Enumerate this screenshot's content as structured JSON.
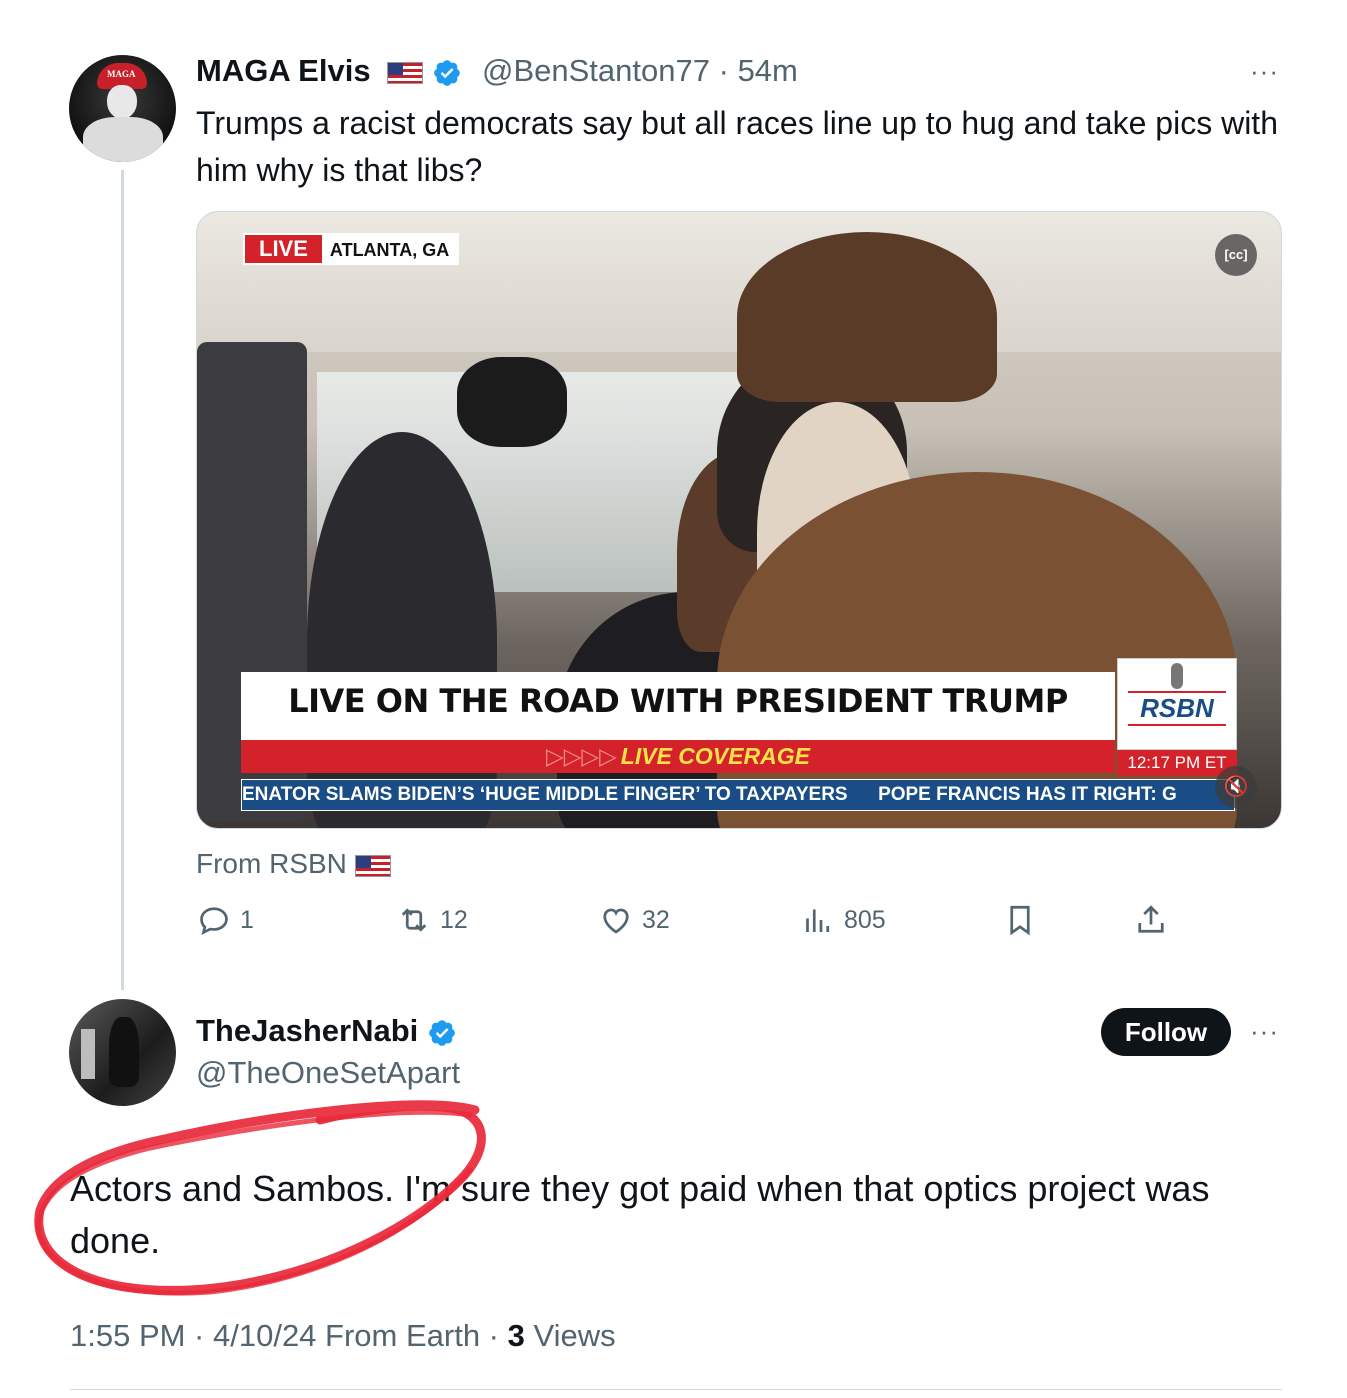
{
  "post": {
    "author_name": "MAGA Elvis",
    "author_handle": "@BenStanton77",
    "separator": "·",
    "time": "54m",
    "more": "···",
    "text": "Trumps a racist democrats say but all races line up to hug and take pics with him why is that libs?",
    "avatar_text": "MAGA",
    "media": {
      "live_label": "LIVE",
      "location": "ATLANTA, GA",
      "cc_label": "[cc]",
      "headline": "LIVE ON THE ROAD WITH PRESIDENT TRUMP",
      "subhead_arrows": "▷▷▷▷",
      "subhead": "LIVE COVERAGE",
      "ticker_1": "ENATOR SLAMS BIDEN’S ‘HUGE MIDDLE FINGER’ TO TAXPAYERS",
      "ticker_2": "POPE FRANCIS HAS IT RIGHT: G",
      "logo": "RSBN",
      "time": "12:17 PM ET",
      "mute_icon": "🔇"
    },
    "source": "From RSBN",
    "actions": {
      "replies": "1",
      "reposts": "12",
      "likes": "32",
      "views": "805"
    }
  },
  "reply": {
    "author_name": "TheJasherNabi",
    "author_handle": "@TheOneSetApart",
    "follow_label": "Follow",
    "more": "···",
    "text": "Actors and Sambos. I'm sure they got paid when that optics project was done.",
    "meta_time": "1:55 PM · 4/10/24 From Earth · ",
    "meta_views_count": "3",
    "meta_views_label": " Views"
  },
  "colors": {
    "verified_blue": "#1d9bf0",
    "secondary_text": "#536471",
    "scribble_red": "#e8283a"
  },
  "icons": [
    "verified-badge-icon",
    "us-flag-icon",
    "reply-icon",
    "repost-icon",
    "like-icon",
    "views-icon",
    "bookmark-icon",
    "share-icon",
    "captions-icon",
    "mute-icon"
  ]
}
